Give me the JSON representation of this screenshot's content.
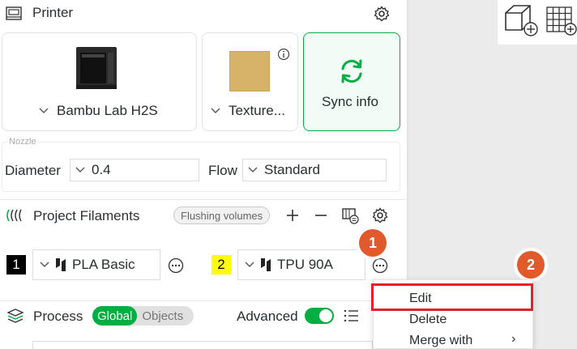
{
  "printer": {
    "title": "Printer",
    "name": "Bambu Lab H2S",
    "plate": "Texture...",
    "sync": "Sync info"
  },
  "nozzle": {
    "group_label": "Nozzle",
    "diameter_label": "Diameter",
    "diameter_value": "0.4",
    "flow_label": "Flow",
    "flow_value": "Standard"
  },
  "filaments": {
    "title": "Project Filaments",
    "flushing": "Flushing volumes",
    "items": [
      {
        "num": "1",
        "name": "PLA Basic",
        "badge_bg": "#000000",
        "badge_fg": "#ffffff"
      },
      {
        "num": "2",
        "name": "TPU 90A",
        "badge_bg": "#ffff00",
        "badge_fg": "#000000"
      }
    ]
  },
  "process": {
    "title": "Process",
    "global": "Global",
    "objects": "Objects",
    "advanced": "Advanced"
  },
  "menu": {
    "items": [
      "Edit",
      "Delete",
      "Merge with"
    ]
  },
  "annotations": {
    "step1": "1",
    "step2": "2"
  },
  "colors": {
    "accent": "#00ae42",
    "callout": "#e05a2b",
    "highlight": "#e0202a"
  }
}
